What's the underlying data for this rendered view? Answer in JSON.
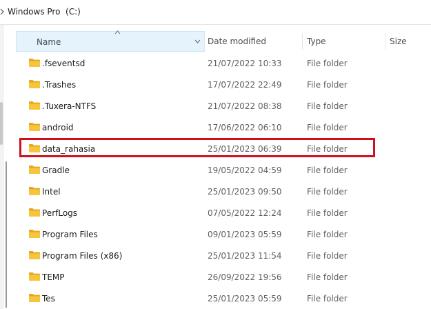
{
  "address_bar": {
    "path": "Windows Pro  (C:)"
  },
  "columns": {
    "name": "Name",
    "date_modified": "Date modified",
    "type": "Type",
    "size": "Size"
  },
  "sort": {
    "column": "name",
    "direction": "ascending"
  },
  "files": [
    {
      "name": ".fseventsd",
      "date": "21/07/2022 10:33",
      "type": "File folder"
    },
    {
      "name": ".Trashes",
      "date": "17/07/2022 22:49",
      "type": "File folder"
    },
    {
      "name": ".Tuxera-NTFS",
      "date": "21/07/2022 08:38",
      "type": "File folder"
    },
    {
      "name": "android",
      "date": "17/06/2022 06:10",
      "type": "File folder"
    },
    {
      "name": "data_rahasia",
      "date": "25/01/2023 06:39",
      "type": "File folder",
      "highlighted": true
    },
    {
      "name": "Gradle",
      "date": "19/05/2022 04:59",
      "type": "File folder"
    },
    {
      "name": "Intel",
      "date": "25/01/2023 09:50",
      "type": "File folder"
    },
    {
      "name": "PerfLogs",
      "date": "07/05/2022 12:24",
      "type": "File folder"
    },
    {
      "name": "Program Files",
      "date": "09/01/2023 05:59",
      "type": "File folder"
    },
    {
      "name": "Program Files (x86)",
      "date": "25/01/2023 11:54",
      "type": "File folder"
    },
    {
      "name": "TEMP",
      "date": "26/09/2022 19:56",
      "type": "File folder"
    },
    {
      "name": "Tes",
      "date": "25/01/2023 05:59",
      "type": "File folder"
    }
  ],
  "colors": {
    "folder_yellow": "#f8c43c",
    "folder_dark": "#e0a81c",
    "header_selected_bg": "#e5f3fd",
    "highlight_border": "#d0101a"
  },
  "icons": {
    "folder": "folder-icon",
    "sort": "sort-up-icon",
    "dropdown": "chevron-down-icon",
    "breadcrumb": "chevron-right-icon"
  }
}
